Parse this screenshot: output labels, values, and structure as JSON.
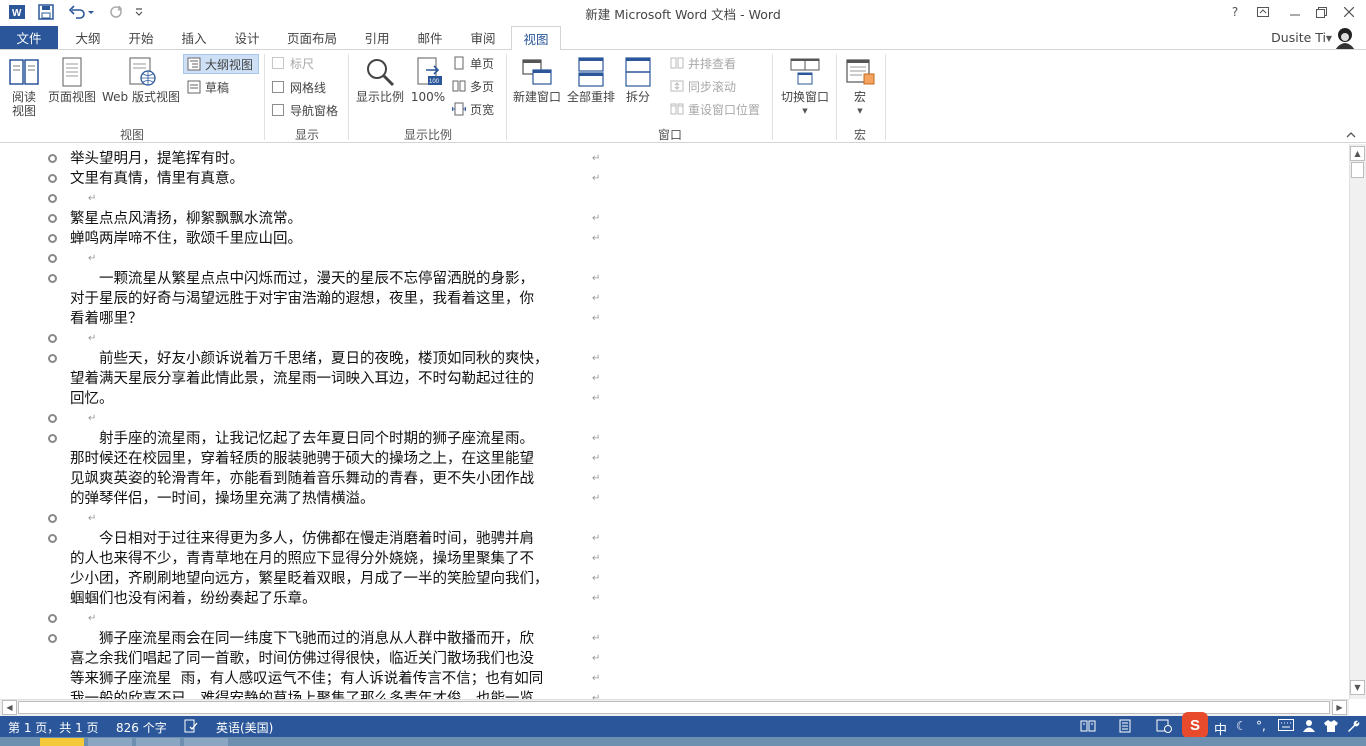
{
  "window": {
    "title": "新建 Microsoft Word 文档 - Word",
    "help": "?",
    "user": "Dusite Ti"
  },
  "tabs": [
    "文件",
    "大纲",
    "开始",
    "插入",
    "设计",
    "页面布局",
    "引用",
    "邮件",
    "审阅",
    "视图"
  ],
  "active_tab": "视图",
  "ribbon": {
    "views": {
      "read_mode_line1": "阅读",
      "read_mode_line2": "视图",
      "print_layout": "页面视图",
      "web_layout": "Web 版式视图",
      "outline": "大纲视图",
      "draft": "草稿",
      "group_label": "视图"
    },
    "show": {
      "ruler": "标尺",
      "gridlines": "网格线",
      "nav_pane": "导航窗格",
      "group_label": "显示"
    },
    "zoom": {
      "zoom": "显示比例",
      "hundred": "100%",
      "one_page": "单页",
      "multi_page": "多页",
      "page_width": "页宽",
      "group_label": "显示比例"
    },
    "window": {
      "new_window": "新建窗口",
      "arrange_all": "全部重排",
      "split": "拆分",
      "side_by_side": "并排查看",
      "sync_scroll": "同步滚动",
      "reset_pos": "重设窗口位置",
      "switch_windows": "切换窗口",
      "group_label": "窗口"
    },
    "macros": {
      "macros": "宏",
      "group_label": "宏"
    }
  },
  "document": {
    "lines": [
      {
        "text": "举头望明月，提笔挥有时。",
        "bullet": true
      },
      {
        "text": "文里有真情，情里有真意。",
        "bullet": true
      },
      {
        "text": "",
        "bullet": true
      },
      {
        "text": "繁星点点风清扬，柳絮飘飘水流常。",
        "bullet": true
      },
      {
        "text": "蝉鸣两岸啼不住，歌颂千里应山回。",
        "bullet": true
      },
      {
        "text": "",
        "bullet": true
      },
      {
        "text": "　　一颗流星从繁星点点中闪烁而过，漫天的星辰不忘停留洒脱的身影，",
        "bullet": true
      },
      {
        "text": "对于星辰的好奇与渴望远胜于对宇宙浩瀚的遐想，夜里，我看着这里，你",
        "bullet": false
      },
      {
        "text": "看着哪里？",
        "bullet": false
      },
      {
        "text": "",
        "bullet": true
      },
      {
        "text": "　　前些天，好友小颜诉说着万千思绪，夏日的夜晚，楼顶如同秋的爽快，",
        "bullet": true
      },
      {
        "text": "望着满天星辰分享着此情此景，流星雨一词映入耳边，不时勾勒起过往的",
        "bullet": false
      },
      {
        "text": "回忆。",
        "bullet": false
      },
      {
        "text": "",
        "bullet": true
      },
      {
        "text": "　　射手座的流星雨，让我记忆起了去年夏日同个时期的狮子座流星雨。",
        "bullet": true
      },
      {
        "text": "那时候还在校园里，穿着轻质的服装驰骋于硕大的操场之上，在这里能望",
        "bullet": false
      },
      {
        "text": "见飒爽英姿的轮滑青年，亦能看到随着音乐舞动的青春，更不失小团作战",
        "bullet": false
      },
      {
        "text": "的弹琴伴侣，一时间，操场里充满了热情横溢。",
        "bullet": false
      },
      {
        "text": "",
        "bullet": true
      },
      {
        "text": "　　今日相对于过往来得更为多人，仿佛都在慢走消磨着时间，驰骋并肩",
        "bullet": true
      },
      {
        "text": "的人也来得不少，青青草地在月的照应下显得分外娆娆，操场里聚集了不",
        "bullet": false
      },
      {
        "text": "少小团，齐刷刷地望向远方，繁星眨着双眼，月成了一半的笑脸望向我们，",
        "bullet": false
      },
      {
        "text": "蝈蝈们也没有闲着，纷纷奏起了乐章。",
        "bullet": false
      },
      {
        "text": "",
        "bullet": true
      },
      {
        "text": "　　狮子座流星雨会在同一纬度下飞驰而过的消息从人群中散播而开，欣",
        "bullet": true
      },
      {
        "text": "喜之余我们唱起了同一首歌，时间仿佛过得很快，临近关门散场我们也没",
        "bullet": false
      },
      {
        "text": "等来狮子座流星  雨，有人感叹运气不佳；有人诉说着传言不信；也有如同",
        "bullet": false
      },
      {
        "text": "我一般的欣喜不已，难得安静的草场上聚集了那么多青年才俊，也能一览",
        "bullet": false
      }
    ]
  },
  "status": {
    "page": "第 1 页，共 1 页",
    "words": "826 个字",
    "language": "英语(美国)"
  },
  "ime": {
    "label": "中"
  }
}
